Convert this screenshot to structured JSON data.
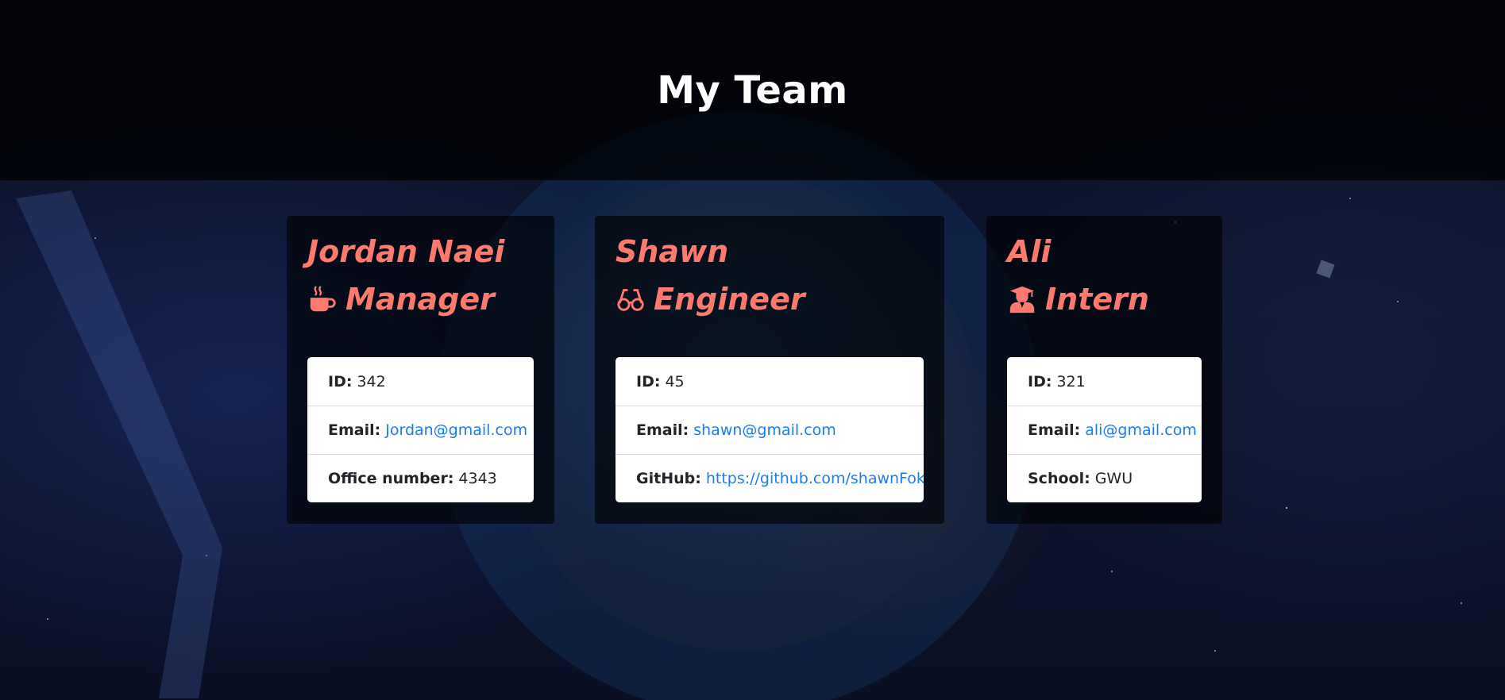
{
  "header": {
    "title": "My Team"
  },
  "colors": {
    "accent": "#ff7a6e",
    "link": "#1e7bf2"
  },
  "employees": [
    {
      "name": "Jordan Naei",
      "role": "Manager",
      "role_icon": "mug-hot-icon",
      "fields": [
        {
          "label": "ID:",
          "value": "342"
        },
        {
          "label": "Email:",
          "value": "Jordan@gmail.com"
        },
        {
          "label": "Office number:",
          "value": "4343"
        }
      ]
    },
    {
      "name": "Shawn",
      "role": "Engineer",
      "role_icon": "glasses-icon",
      "fields": [
        {
          "label": "ID:",
          "value": "45"
        },
        {
          "label": "Email:",
          "value": "shawn@gmail.com"
        },
        {
          "label": "GitHub:",
          "value": "https://github.com/shawnFok"
        }
      ]
    },
    {
      "name": "Ali",
      "role": "Intern",
      "role_icon": "user-graduate-icon",
      "fields": [
        {
          "label": "ID:",
          "value": "321"
        },
        {
          "label": "Email:",
          "value": "ali@gmail.com"
        },
        {
          "label": "School:",
          "value": "GWU"
        }
      ]
    }
  ]
}
